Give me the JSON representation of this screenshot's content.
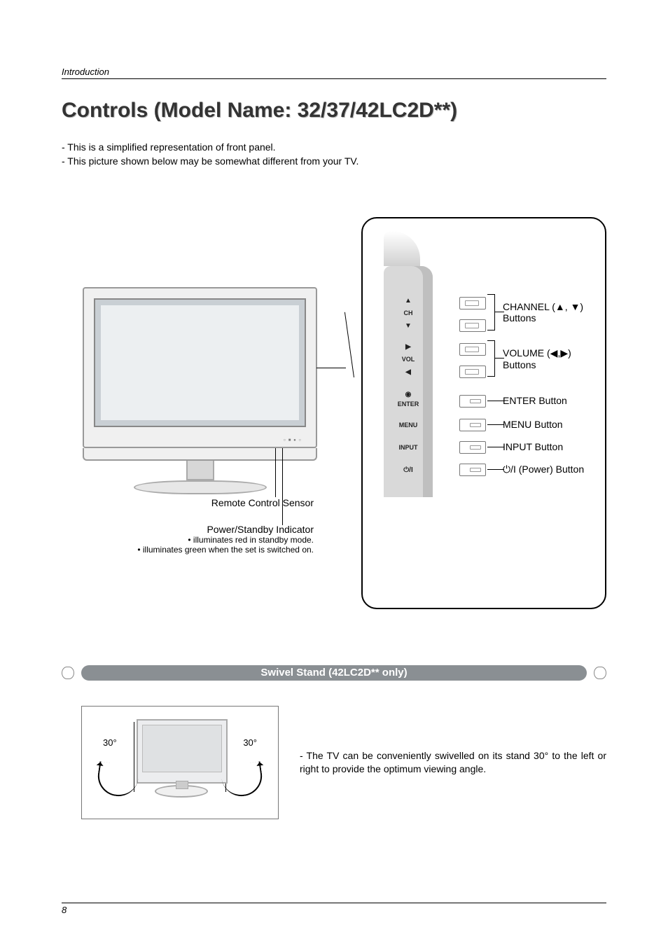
{
  "header": {
    "section": "Introduction"
  },
  "title": "Controls (Model Name: 32/37/42LC2D**)",
  "intro": {
    "line1": "- This is a simplified representation of front panel.",
    "line2": "- This picture shown below may be somewhat different from your TV."
  },
  "tv_front": {
    "chin_marks": "○ ■ ● ○",
    "sensor_label": "Remote Control Sensor",
    "indicator_label": "Power/Standby Indicator",
    "indicator_sub1": "• illuminates red in standby mode.",
    "indicator_sub2": "• illuminates green when the set is switched on."
  },
  "callout": {
    "ch_up": "▲",
    "ch_label": "CH",
    "ch_down": "▼",
    "vol_right": "▶",
    "vol_label": "VOL",
    "vol_left": "◀",
    "enter_dot": "◉",
    "enter_label": "ENTER",
    "menu_label": "MENU",
    "input_label": "INPUT",
    "power_glyph": "⏻/I",
    "right": {
      "channel": "CHANNEL (▲, ▼) Buttons",
      "volume": "VOLUME (◀,▶) Buttons",
      "enter": "ENTER Button",
      "menu": "MENU Button",
      "input": "INPUT Button",
      "power": "⏻/I (Power) Button"
    }
  },
  "swivel": {
    "header": "Swivel Stand (42LC2D** only)",
    "deg_left": "30°",
    "deg_right": "30°",
    "text": "- The TV can be conveniently swivelled on its stand 30° to the left or right to provide the optimum viewing angle."
  },
  "footer": {
    "page_number": "8"
  }
}
